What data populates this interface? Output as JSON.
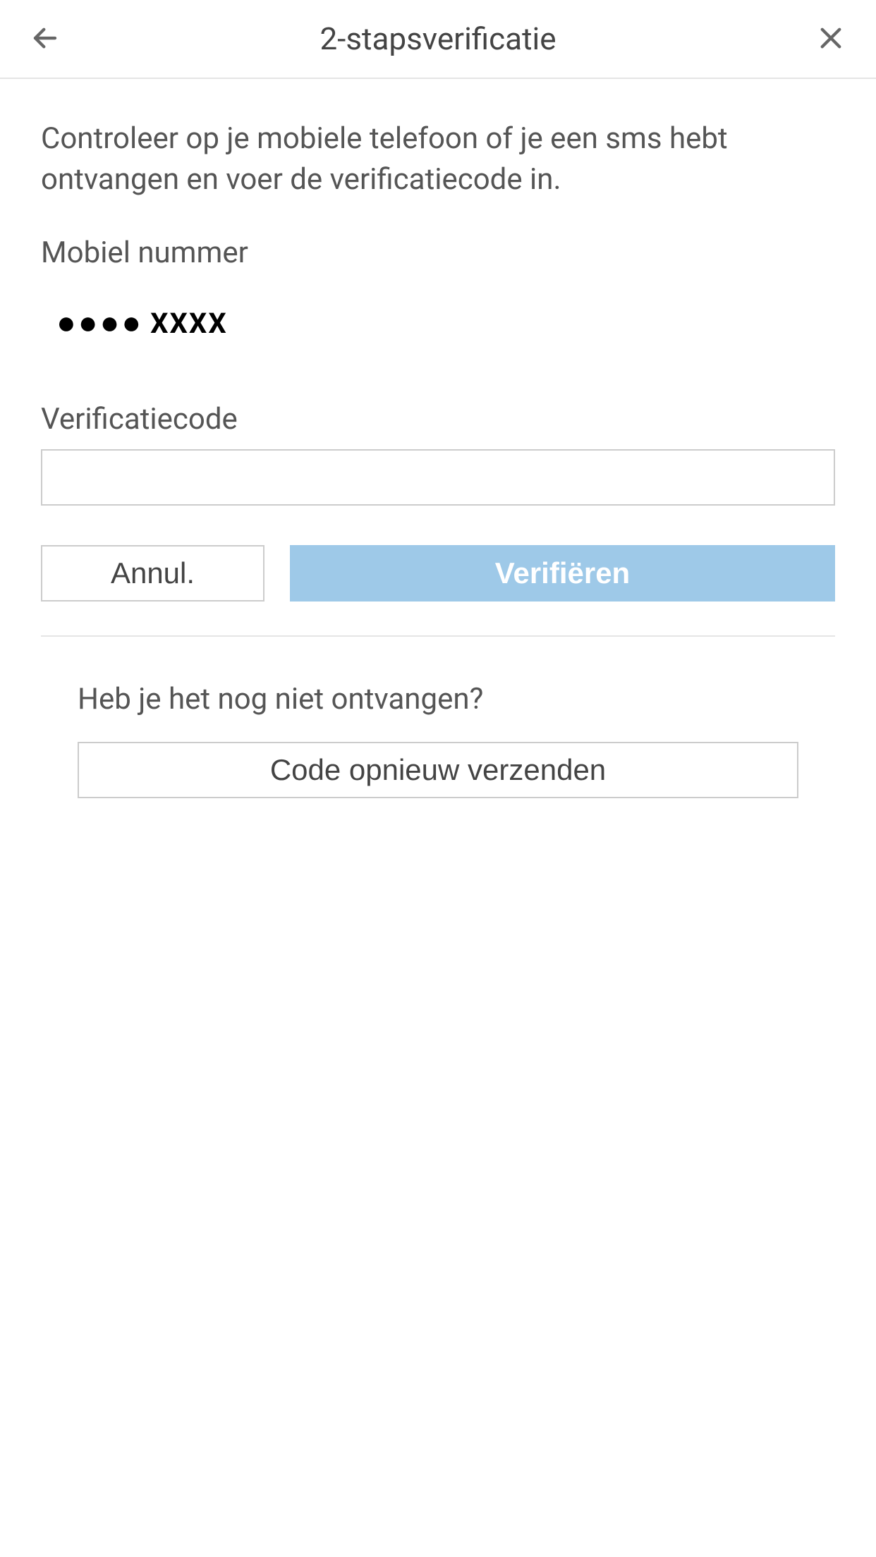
{
  "header": {
    "title": "2-stapsverificatie"
  },
  "main": {
    "instruction": "Controleer op je mobiele telefoon of je een sms hebt ontvangen en voer de verificatiecode in.",
    "mobile_label": "Mobiel nummer",
    "mobile_number_masked": "XXXX",
    "verification_label": "Verificatiecode",
    "verification_value": "",
    "cancel_label": "Annul.",
    "verify_label": "Verifiëren"
  },
  "resend": {
    "prompt": "Heb je het nog niet ontvangen?",
    "button_label": "Code opnieuw verzenden"
  }
}
